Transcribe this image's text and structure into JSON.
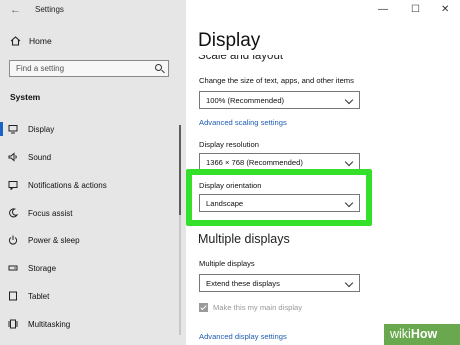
{
  "window": {
    "title": "Settings",
    "back_glyph": "←",
    "minimize_glyph": "—",
    "maximize_glyph": "☐",
    "close_glyph": "✕"
  },
  "sidebar": {
    "home_label": "Home",
    "search_placeholder": "Find a setting",
    "section_label": "System",
    "items": [
      {
        "label": "Display",
        "icon": "display-icon",
        "active": true
      },
      {
        "label": "Sound",
        "icon": "speaker-icon"
      },
      {
        "label": "Notifications & actions",
        "icon": "notification-icon"
      },
      {
        "label": "Focus assist",
        "icon": "moon-icon"
      },
      {
        "label": "Power & sleep",
        "icon": "power-icon"
      },
      {
        "label": "Storage",
        "icon": "storage-icon"
      },
      {
        "label": "Tablet",
        "icon": "tablet-icon"
      },
      {
        "label": "Multitasking",
        "icon": "multitasking-icon"
      }
    ]
  },
  "main": {
    "title": "Display",
    "section_scale": "Scale and layout",
    "scale_label": "Change the size of text, apps, and other items",
    "scale_value": "100% (Recommended)",
    "advanced_scaling_link": "Advanced scaling settings",
    "resolution_label": "Display resolution",
    "resolution_value": "1366 × 768 (Recommended)",
    "orientation_label": "Display orientation",
    "orientation_value": "Landscape",
    "section_multiple": "Multiple displays",
    "multiple_label": "Multiple displays",
    "multiple_value": "Extend these displays",
    "main_display_label": "Make this my main display",
    "main_display_checked": true,
    "advanced_display_link": "Advanced display settings"
  },
  "watermark": {
    "wiki": "wiki",
    "how": "How"
  },
  "colors": {
    "accent": "#1c63c5",
    "highlight": "#35e02b",
    "link": "#1f5cb3",
    "watermark_bg": "#6aa84f"
  }
}
